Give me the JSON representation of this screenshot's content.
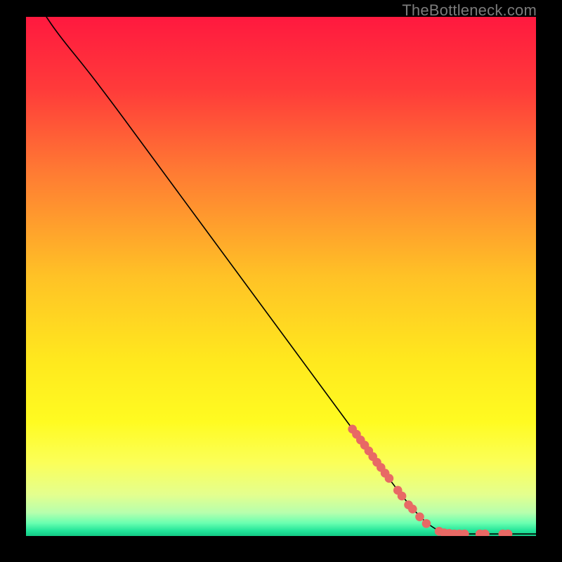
{
  "watermark": "TheBottleneck.com",
  "chart_data": {
    "type": "line",
    "note": "Axes have no visible tick labels; x and y are normalized 0–100. Curve drops from top-left to bottom-right then flattens. Salmon markers cluster along the lower-right portion of the curve.",
    "xlim": [
      0,
      100
    ],
    "ylim": [
      0,
      100
    ],
    "title": "",
    "xlabel": "",
    "ylabel": "",
    "gradient_stops": [
      {
        "offset": 0.0,
        "color": "#ff193f"
      },
      {
        "offset": 0.14,
        "color": "#ff3b3a"
      },
      {
        "offset": 0.3,
        "color": "#ff7b33"
      },
      {
        "offset": 0.5,
        "color": "#ffc226"
      },
      {
        "offset": 0.66,
        "color": "#ffe81e"
      },
      {
        "offset": 0.78,
        "color": "#fffb21"
      },
      {
        "offset": 0.86,
        "color": "#fbff5a"
      },
      {
        "offset": 0.92,
        "color": "#e4ff8e"
      },
      {
        "offset": 0.955,
        "color": "#b7ffad"
      },
      {
        "offset": 0.975,
        "color": "#6affb0"
      },
      {
        "offset": 0.99,
        "color": "#22e59a"
      },
      {
        "offset": 1.0,
        "color": "#14c884"
      }
    ],
    "curve": [
      {
        "x": 4.0,
        "y": 100.0
      },
      {
        "x": 5.5,
        "y": 97.8
      },
      {
        "x": 8.0,
        "y": 94.6
      },
      {
        "x": 11.0,
        "y": 91.0
      },
      {
        "x": 14.0,
        "y": 87.2
      },
      {
        "x": 17.0,
        "y": 83.3
      },
      {
        "x": 21.0,
        "y": 78.0
      },
      {
        "x": 26.0,
        "y": 71.3
      },
      {
        "x": 32.0,
        "y": 63.3
      },
      {
        "x": 38.0,
        "y": 55.3
      },
      {
        "x": 44.0,
        "y": 47.3
      },
      {
        "x": 50.0,
        "y": 39.3
      },
      {
        "x": 56.0,
        "y": 31.3
      },
      {
        "x": 62.0,
        "y": 23.3
      },
      {
        "x": 68.0,
        "y": 15.3
      },
      {
        "x": 74.0,
        "y": 7.3
      },
      {
        "x": 78.0,
        "y": 2.9
      },
      {
        "x": 80.5,
        "y": 1.2
      },
      {
        "x": 82.0,
        "y": 0.6
      },
      {
        "x": 84.0,
        "y": 0.4
      },
      {
        "x": 88.0,
        "y": 0.4
      },
      {
        "x": 92.0,
        "y": 0.4
      },
      {
        "x": 96.0,
        "y": 0.4
      },
      {
        "x": 100.0,
        "y": 0.4
      }
    ],
    "markers": [
      {
        "x": 64.0,
        "y": 20.6
      },
      {
        "x": 64.8,
        "y": 19.6
      },
      {
        "x": 65.6,
        "y": 18.5
      },
      {
        "x": 66.4,
        "y": 17.5
      },
      {
        "x": 67.2,
        "y": 16.4
      },
      {
        "x": 68.0,
        "y": 15.3
      },
      {
        "x": 68.8,
        "y": 14.2
      },
      {
        "x": 69.6,
        "y": 13.2
      },
      {
        "x": 70.4,
        "y": 12.1
      },
      {
        "x": 71.2,
        "y": 11.1
      },
      {
        "x": 72.9,
        "y": 8.8
      },
      {
        "x": 73.7,
        "y": 7.7
      },
      {
        "x": 75.0,
        "y": 6.0
      },
      {
        "x": 75.8,
        "y": 5.2
      },
      {
        "x": 77.2,
        "y": 3.7
      },
      {
        "x": 78.5,
        "y": 2.4
      },
      {
        "x": 81.0,
        "y": 0.9
      },
      {
        "x": 82.0,
        "y": 0.6
      },
      {
        "x": 83.0,
        "y": 0.5
      },
      {
        "x": 84.0,
        "y": 0.4
      },
      {
        "x": 85.0,
        "y": 0.4
      },
      {
        "x": 86.0,
        "y": 0.4
      },
      {
        "x": 89.0,
        "y": 0.4
      },
      {
        "x": 90.0,
        "y": 0.4
      },
      {
        "x": 93.5,
        "y": 0.4
      },
      {
        "x": 94.5,
        "y": 0.4
      }
    ],
    "marker_style": {
      "r": 6.3,
      "fill": "#e86965"
    }
  }
}
